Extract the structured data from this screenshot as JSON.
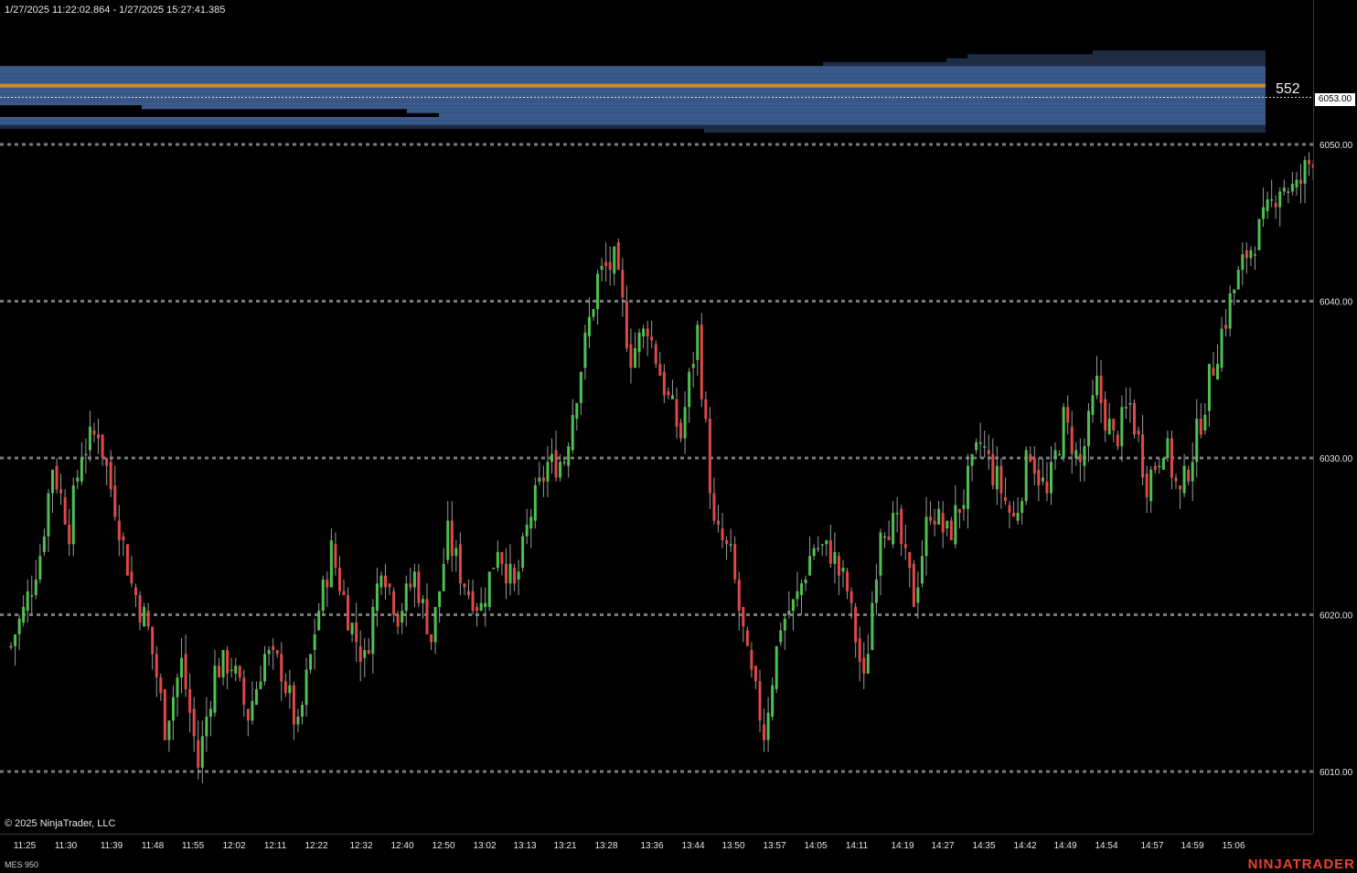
{
  "header": {
    "range": "1/27/2025 11:22:02.864 - 1/27/2025 15:27:41.385"
  },
  "footer": {
    "copyright": "© 2025 NinjaTrader, LLC",
    "instrument": "MES 950",
    "brand": "NINJATRADER"
  },
  "volume_profile": {
    "poc_volume": "552",
    "colors": {
      "value_area": "#3a5a8c",
      "outside": "#1e2c44",
      "poc": "#d4891c"
    }
  },
  "last_price_label": "6053.00",
  "colors": {
    "up": "#4fc04f",
    "down": "#e04848",
    "wick": "#9a9a9a",
    "grid": "#7a7a7a",
    "background": "#000000",
    "brand": "#e8442c"
  },
  "chart_data": {
    "type": "candlestick",
    "title": "",
    "ylim": [
      6004,
      6060
    ],
    "y_ticks": [
      6010,
      6020,
      6030,
      6040,
      6050
    ],
    "y_tick_labels": [
      "6010.00",
      "6020.00",
      "6030.00",
      "6040.00",
      "6050.00"
    ],
    "x_ticks": [
      "11:25",
      "11:30",
      "11:39",
      "11:48",
      "11:55",
      "12:02",
      "12:11",
      "12:22",
      "12:32",
      "12:40",
      "12:50",
      "13:02",
      "13:13",
      "13:21",
      "13:28",
      "13:36",
      "13:44",
      "13:50",
      "13:57",
      "14:05",
      "14:11",
      "14:19",
      "14:27",
      "14:35",
      "14:42",
      "14:49",
      "14:54",
      "14:57",
      "14:59",
      "15:06"
    ],
    "last_price": 6053,
    "poc_price": 6053.75,
    "close_path": [
      [
        0,
        6018.0
      ],
      [
        4,
        6021.0
      ],
      [
        7,
        6024.0
      ],
      [
        10,
        6029.5
      ],
      [
        14,
        6025.5
      ],
      [
        17,
        6030.5
      ],
      [
        21,
        6031.8
      ],
      [
        25,
        6027.0
      ],
      [
        29,
        6022.0
      ],
      [
        33,
        6019.0
      ],
      [
        37,
        6013.0
      ],
      [
        41,
        6017.0
      ],
      [
        45,
        6010.5
      ],
      [
        49,
        6016.5
      ],
      [
        53,
        6017.0
      ],
      [
        57,
        6013.5
      ],
      [
        61,
        6017.5
      ],
      [
        65,
        6016.5
      ],
      [
        69,
        6012.5
      ],
      [
        73,
        6019.0
      ],
      [
        77,
        6024.0
      ],
      [
        81,
        6020.0
      ],
      [
        85,
        6017.0
      ],
      [
        89,
        6023.5
      ],
      [
        93,
        6020.0
      ],
      [
        97,
        6022.5
      ],
      [
        101,
        6018.5
      ],
      [
        105,
        6025.0
      ],
      [
        109,
        6022.0
      ],
      [
        113,
        6020.5
      ],
      [
        117,
        6024.5
      ],
      [
        121,
        6021.5
      ],
      [
        125,
        6026.5
      ],
      [
        129,
        6029.5
      ],
      [
        133,
        6030.0
      ],
      [
        137,
        6036.0
      ],
      [
        141,
        6041.5
      ],
      [
        145,
        6042.5
      ],
      [
        149,
        6036.5
      ],
      [
        153,
        6038.5
      ],
      [
        157,
        6034.5
      ],
      [
        161,
        6031.5
      ],
      [
        165,
        6038.0
      ],
      [
        169,
        6025.5
      ],
      [
        173,
        6023.5
      ],
      [
        177,
        6017.0
      ],
      [
        181,
        6012.5
      ],
      [
        185,
        6019.5
      ],
      [
        189,
        6021.0
      ],
      [
        193,
        6024.5
      ],
      [
        197,
        6024.0
      ],
      [
        201,
        6021.5
      ],
      [
        205,
        6015.5
      ],
      [
        209,
        6026.0
      ],
      [
        213,
        6025.5
      ],
      [
        217,
        6021.0
      ],
      [
        221,
        6027.0
      ],
      [
        225,
        6025.0
      ],
      [
        229,
        6027.5
      ],
      [
        233,
        6031.0
      ],
      [
        237,
        6028.5
      ],
      [
        241,
        6026.0
      ],
      [
        245,
        6030.5
      ],
      [
        249,
        6027.5
      ],
      [
        253,
        6032.5
      ],
      [
        257,
        6029.5
      ],
      [
        261,
        6034.5
      ],
      [
        265,
        6031.0
      ],
      [
        269,
        6033.5
      ],
      [
        273,
        6028.5
      ],
      [
        277,
        6031.0
      ],
      [
        281,
        6027.5
      ],
      [
        285,
        6031.5
      ],
      [
        289,
        6036.0
      ],
      [
        293,
        6040.0
      ],
      [
        297,
        6043.0
      ],
      [
        301,
        6045.0
      ],
      [
        305,
        6047.5
      ],
      [
        309,
        6047.0
      ],
      [
        313,
        6049.5
      ],
      [
        317,
        6047.5
      ],
      [
        321,
        6048.5
      ],
      [
        325,
        6051.0
      ],
      [
        329,
        6053.0
      ]
    ],
    "volume_profile": {
      "value_area_range": [
        6051.25,
        6055.0
      ],
      "profile_range": [
        6050.75,
        6056.0
      ]
    }
  }
}
